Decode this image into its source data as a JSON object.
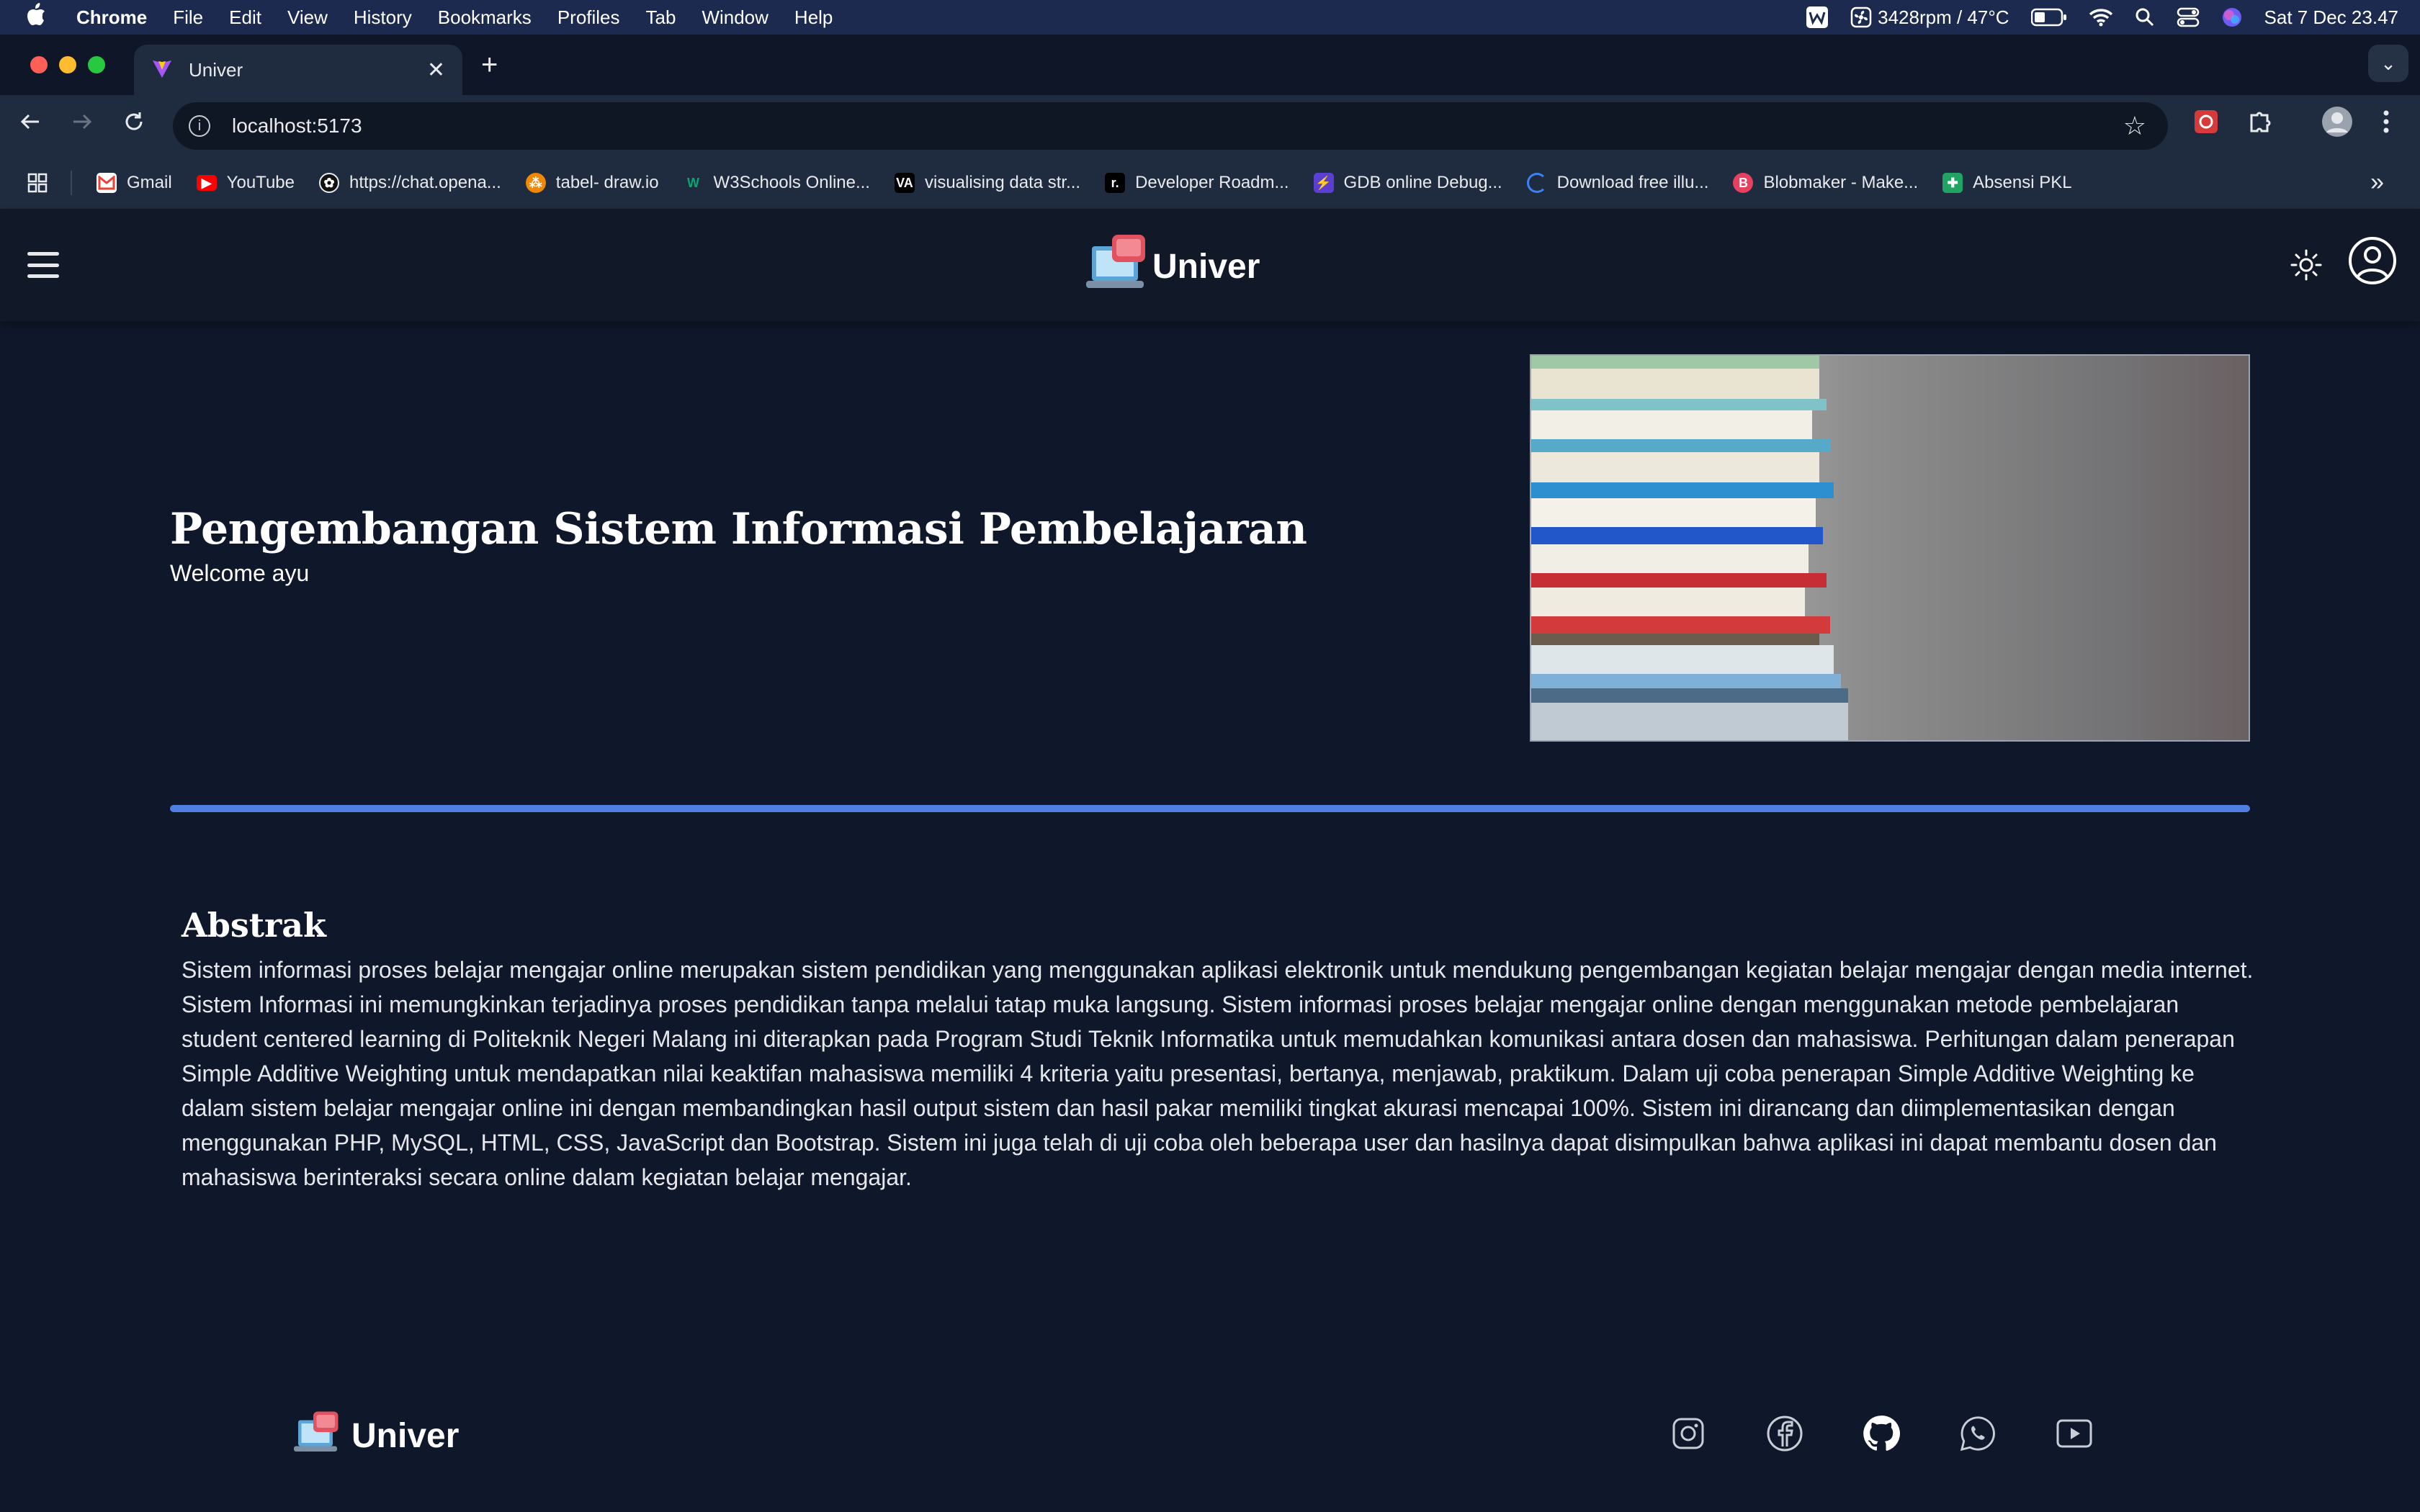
{
  "menubar": {
    "app": "Chrome",
    "items": [
      "File",
      "Edit",
      "View",
      "History",
      "Bookmarks",
      "Profiles",
      "Tab",
      "Window",
      "Help"
    ],
    "fan_status": "3428rpm / 47°C",
    "datetime": "Sat 7 Dec  23.47"
  },
  "browser": {
    "tab_title": "Univer",
    "url": "localhost:5173",
    "bookmarks": [
      {
        "label": "Gmail",
        "icon": "gmail-icon"
      },
      {
        "label": "YouTube",
        "icon": "youtube-icon"
      },
      {
        "label": "https://chat.opena...",
        "icon": "openai-icon"
      },
      {
        "label": "tabel- draw.io",
        "icon": "drawio-icon"
      },
      {
        "label": "W3Schools Online...",
        "icon": "w3schools-icon"
      },
      {
        "label": "visualising data str...",
        "icon": "visualgo-icon"
      },
      {
        "label": "Developer Roadm...",
        "icon": "roadmap-icon"
      },
      {
        "label": "GDB online Debug...",
        "icon": "gdb-icon"
      },
      {
        "label": "Download free illu...",
        "icon": "download-icon"
      },
      {
        "label": "Blobmaker - Make...",
        "icon": "blobmaker-icon"
      },
      {
        "label": "Absensi PKL",
        "icon": "sheets-icon"
      }
    ]
  },
  "navbar": {
    "brand": "Univer"
  },
  "hero": {
    "title": "Pengembangan Sistem Informasi Pembelajaran",
    "welcome": "Welcome ayu"
  },
  "abstract": {
    "heading": "Abstrak",
    "body": "Sistem informasi proses belajar mengajar online merupakan sistem pendidikan yang menggunakan aplikasi elektronik untuk mendukung pengembangan kegiatan belajar mengajar dengan media internet. Sistem Informasi ini memungkinkan terjadinya proses pendidikan tanpa melalui tatap muka langsung. Sistem informasi proses belajar mengajar online dengan menggunakan metode pembelajaran student centered learning di Politeknik Negeri Malang ini diterapkan pada Program Studi Teknik Informatika untuk memudahkan komunikasi antara dosen dan mahasiswa. Perhitungan dalam penerapan Simple Additive Weighting untuk mendapatkan nilai keaktifan mahasiswa memiliki 4 kriteria yaitu presentasi, bertanya, menjawab, praktikum. Dalam uji coba penerapan Simple Additive Weighting ke dalam sistem belajar mengajar online ini dengan membandingkan hasil output sistem dan hasil pakar memiliki tingkat akurasi mencapai 100%. Sistem ini dirancang dan diimplementasikan dengan menggunakan PHP, MySQL, HTML, CSS, JavaScript dan Bootstrap. Sistem ini juga telah di uji coba oleh beberapa user dan hasilnya dapat disimpulkan bahwa aplikasi ini dapat membantu dosen dan mahasiswa berinteraksi secara online dalam kegiatan belajar mengajar."
  },
  "footer": {
    "brand": "Univer",
    "socials": [
      "instagram-icon",
      "facebook-icon",
      "github-icon",
      "whatsapp-icon",
      "youtube-icon"
    ]
  },
  "colors": {
    "page_bg": "#0f172a",
    "navbar_bg": "#111827",
    "divider": "#4f7fe0"
  }
}
